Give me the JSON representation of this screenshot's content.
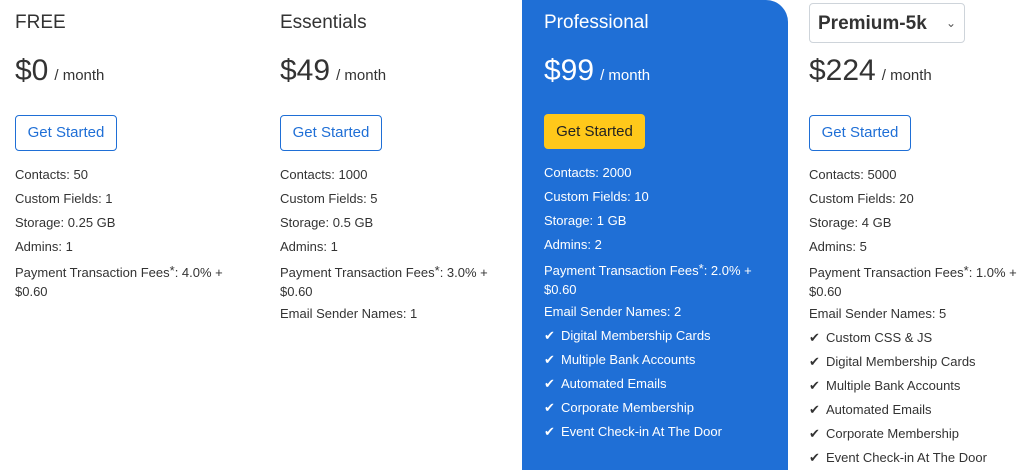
{
  "plans": [
    {
      "name": "FREE",
      "price": "$0",
      "period": "/ month",
      "cta_label": "Get Started",
      "contacts": "Contacts: 50",
      "custom_fields": "Custom Fields: 1",
      "storage": "Storage: 0.25 GB",
      "admins": "Admins: 1",
      "fees_label": "Payment Transaction Fees",
      "fees_star": "*",
      "fees_value": ": 4.0% + $0.60"
    },
    {
      "name": "Essentials",
      "price": "$49",
      "period": "/ month",
      "cta_label": "Get Started",
      "contacts": "Contacts: 1000",
      "custom_fields": "Custom Fields: 5",
      "storage": "Storage: 0.5 GB",
      "admins": "Admins: 1",
      "fees_label": "Payment Transaction Fees",
      "fees_star": "*",
      "fees_value": ": 3.0% + $0.60",
      "sender_names": "Email Sender Names: 1"
    },
    {
      "name": "Professional",
      "price": "$99",
      "period": "/ month",
      "cta_label": "Get Started",
      "contacts": "Contacts: 2000",
      "custom_fields": "Custom Fields: 10",
      "storage": "Storage: 1 GB",
      "admins": "Admins: 2",
      "fees_label": "Payment Transaction Fees",
      "fees_star": "*",
      "fees_value": ": 2.0% + $0.60",
      "sender_names": "Email Sender Names: 2",
      "checks": [
        "Digital Membership Cards",
        "Multiple Bank Accounts",
        "Automated Emails",
        "Corporate Membership",
        "Event Check-in At The Door"
      ]
    },
    {
      "name": "Premium-5k",
      "price": "$224",
      "period": "/ month",
      "cta_label": "Get Started",
      "contacts": "Contacts: 5000",
      "custom_fields": "Custom Fields: 20",
      "storage": "Storage: 4 GB",
      "admins": "Admins: 5",
      "fees_label": "Payment Transaction Fees",
      "fees_star": "*",
      "fees_value": ": 1.0% + $0.60",
      "sender_names": "Email Sender Names: 5",
      "checks": [
        "Custom CSS & JS",
        "Digital Membership Cards",
        "Multiple Bank Accounts",
        "Automated Emails",
        "Corporate Membership",
        "Event Check-in At The Door"
      ]
    }
  ],
  "icons": {
    "check": "check-icon",
    "dropdown": "chevron-down-icon"
  },
  "colors": {
    "highlight": "#1f6fd6",
    "cta_highlight": "#ffc81a",
    "text": "#333333"
  }
}
